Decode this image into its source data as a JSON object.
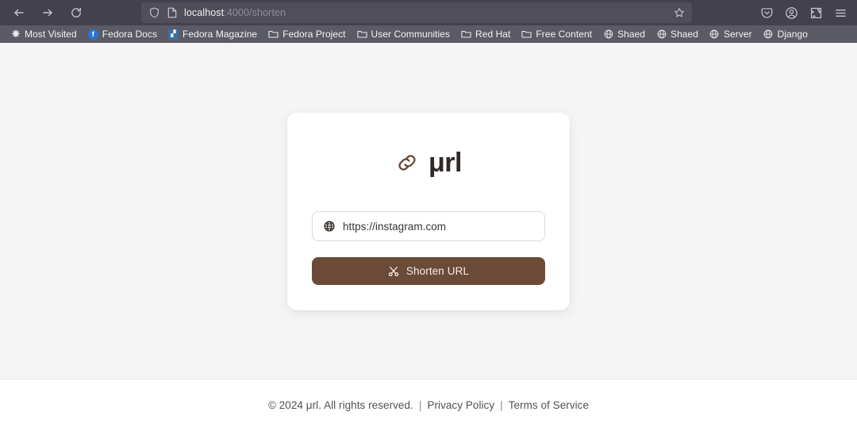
{
  "browser": {
    "nav": {
      "back_icon": "arrow-left-icon",
      "forward_icon": "arrow-right-icon",
      "reload_icon": "reload-icon"
    },
    "urlbar": {
      "shield_icon": "shield-icon",
      "page_icon": "page-document-icon",
      "host": "localhost",
      "path": ":4000/shorten",
      "bookmark_star_icon": "star-icon"
    },
    "toolbar_right": [
      {
        "name": "pocket-save-icon",
        "glyph": "pocket"
      },
      {
        "name": "account-icon",
        "glyph": "account"
      },
      {
        "name": "extensions-icon",
        "glyph": "puzzle"
      },
      {
        "name": "app-menu-icon",
        "glyph": "hamburger"
      }
    ],
    "bookmarks": [
      {
        "label": "Most Visited",
        "icon": "gear-icon",
        "icon_type": "gear"
      },
      {
        "label": "Fedora Docs",
        "icon": "fedora-logo-icon",
        "icon_type": "fedora-round"
      },
      {
        "label": "Fedora Magazine",
        "icon": "fedora-magazine-icon",
        "icon_type": "fedora-square"
      },
      {
        "label": "Fedora Project",
        "icon": "folder-icon",
        "icon_type": "folder"
      },
      {
        "label": "User Communities",
        "icon": "folder-icon",
        "icon_type": "folder"
      },
      {
        "label": "Red Hat",
        "icon": "folder-icon",
        "icon_type": "folder"
      },
      {
        "label": "Free Content",
        "icon": "folder-icon",
        "icon_type": "folder"
      },
      {
        "label": "Shaed",
        "icon": "globe-icon",
        "icon_type": "globe"
      },
      {
        "label": "Shaed",
        "icon": "globe-icon",
        "icon_type": "globe"
      },
      {
        "label": "Server",
        "icon": "globe-icon",
        "icon_type": "globe"
      },
      {
        "label": "Django",
        "icon": "globe-icon",
        "icon_type": "globe"
      }
    ]
  },
  "card": {
    "brand": {
      "icon": "link-chain-icon",
      "text": "μrl"
    },
    "url_input": {
      "icon": "globe-icon",
      "value": "https://instagram.com",
      "placeholder": "https://instagram.com"
    },
    "submit": {
      "icon": "scissors-icon",
      "label": "Shorten URL"
    }
  },
  "footer": {
    "copyright": "© 2024 μrl. All rights reserved.",
    "separator_1": "|",
    "privacy_label": "Privacy Policy",
    "separator_2": "|",
    "terms_label": "Terms of Service"
  },
  "colors": {
    "brand_brown": "#6b4a38",
    "page_background": "#f5f5f6",
    "card_background": "#ffffff",
    "chrome_background": "#42414d",
    "bookmark_bar_background": "#5b5b66"
  }
}
